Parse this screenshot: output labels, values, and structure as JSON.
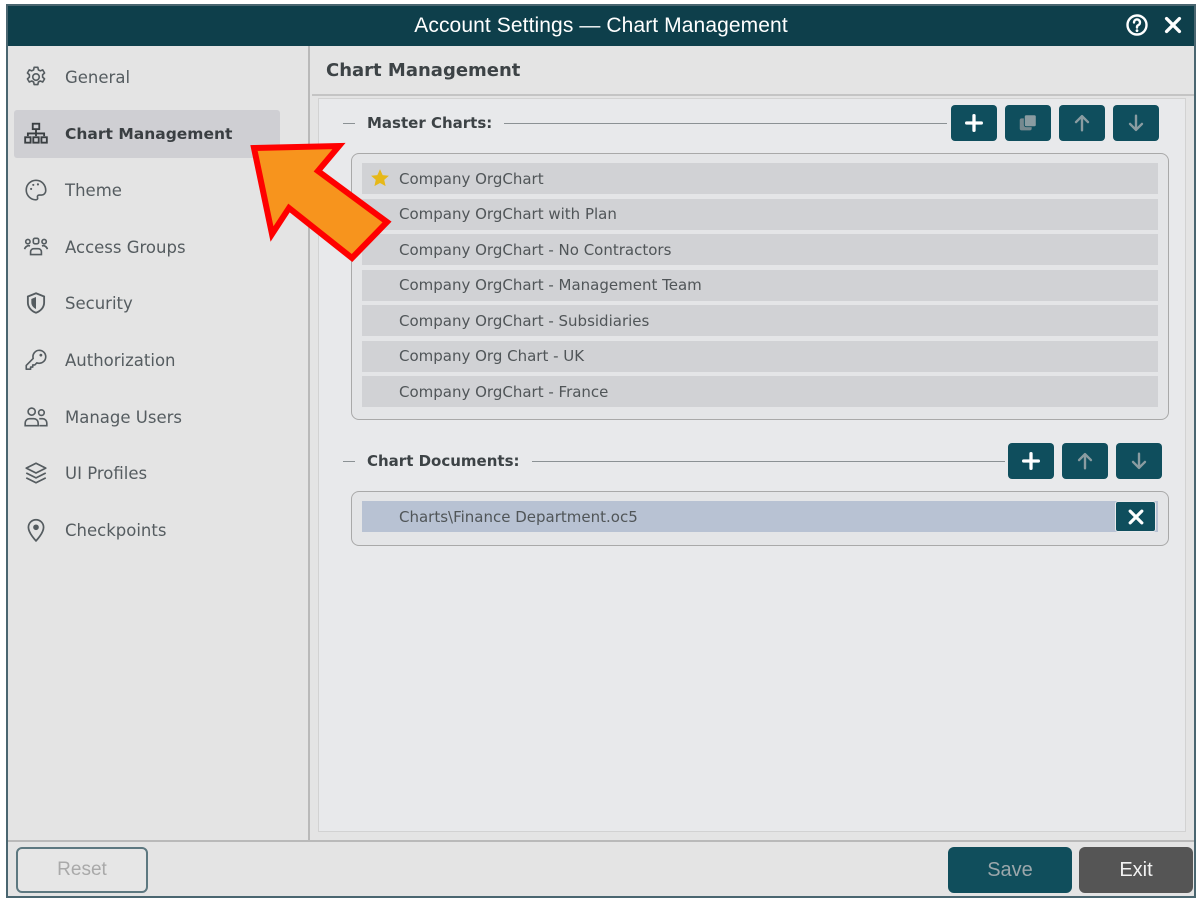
{
  "window": {
    "title": "Account Settings — Chart Management",
    "help_icon": "help-circle-icon",
    "close_icon": "close-icon"
  },
  "sidebar": {
    "items": [
      {
        "label": "General",
        "icon": "gear-icon",
        "active": false
      },
      {
        "label": "Chart Management",
        "icon": "org-chart-icon",
        "active": true
      },
      {
        "label": "Theme",
        "icon": "palette-icon",
        "active": false
      },
      {
        "label": "Access Groups",
        "icon": "group-icon",
        "active": false
      },
      {
        "label": "Security",
        "icon": "shield-icon",
        "active": false
      },
      {
        "label": "Authorization",
        "icon": "key-icon",
        "active": false
      },
      {
        "label": "Manage Users",
        "icon": "users-icon",
        "active": false
      },
      {
        "label": "UI Profiles",
        "icon": "layers-icon",
        "active": false
      },
      {
        "label": "Checkpoints",
        "icon": "map-pin-icon",
        "active": false
      }
    ]
  },
  "main": {
    "header": "Chart Management",
    "master_charts": {
      "label": "Master Charts:",
      "buttons": [
        {
          "name": "add",
          "icon": "plus-icon",
          "enabled": true
        },
        {
          "name": "copy",
          "icon": "copy-icon",
          "enabled": false
        },
        {
          "name": "move-up",
          "icon": "arrow-up-icon",
          "enabled": false
        },
        {
          "name": "move-down",
          "icon": "arrow-down-icon",
          "enabled": false
        }
      ],
      "items": [
        {
          "label": "Company OrgChart",
          "default": true
        },
        {
          "label": "Company OrgChart with Plan",
          "default": false
        },
        {
          "label": "Company OrgChart - No Contractors",
          "default": false
        },
        {
          "label": "Company OrgChart - Management Team",
          "default": false
        },
        {
          "label": "Company OrgChart - Subsidiaries",
          "default": false
        },
        {
          "label": "Company Org Chart - UK",
          "default": false
        },
        {
          "label": "Company OrgChart - France",
          "default": false
        }
      ]
    },
    "chart_documents": {
      "label": "Chart Documents:",
      "buttons": [
        {
          "name": "add",
          "icon": "plus-icon",
          "enabled": true
        },
        {
          "name": "move-up",
          "icon": "arrow-up-icon",
          "enabled": false
        },
        {
          "name": "move-down",
          "icon": "arrow-down-icon",
          "enabled": false
        }
      ],
      "items": [
        {
          "label": "Charts\\Finance Department.oc5",
          "selected": true
        }
      ]
    }
  },
  "footer": {
    "reset_label": "Reset",
    "save_label": "Save",
    "exit_label": "Exit"
  },
  "annotation": {
    "type": "callout-arrow",
    "target": "Chart Management",
    "fill": "#f7941d",
    "stroke": "#ff0000"
  },
  "colors": {
    "titlebar": "#0e3f4b",
    "accent": "#0f4e5d",
    "star": "#e6b818",
    "selected_row": "#b8c2d3"
  }
}
